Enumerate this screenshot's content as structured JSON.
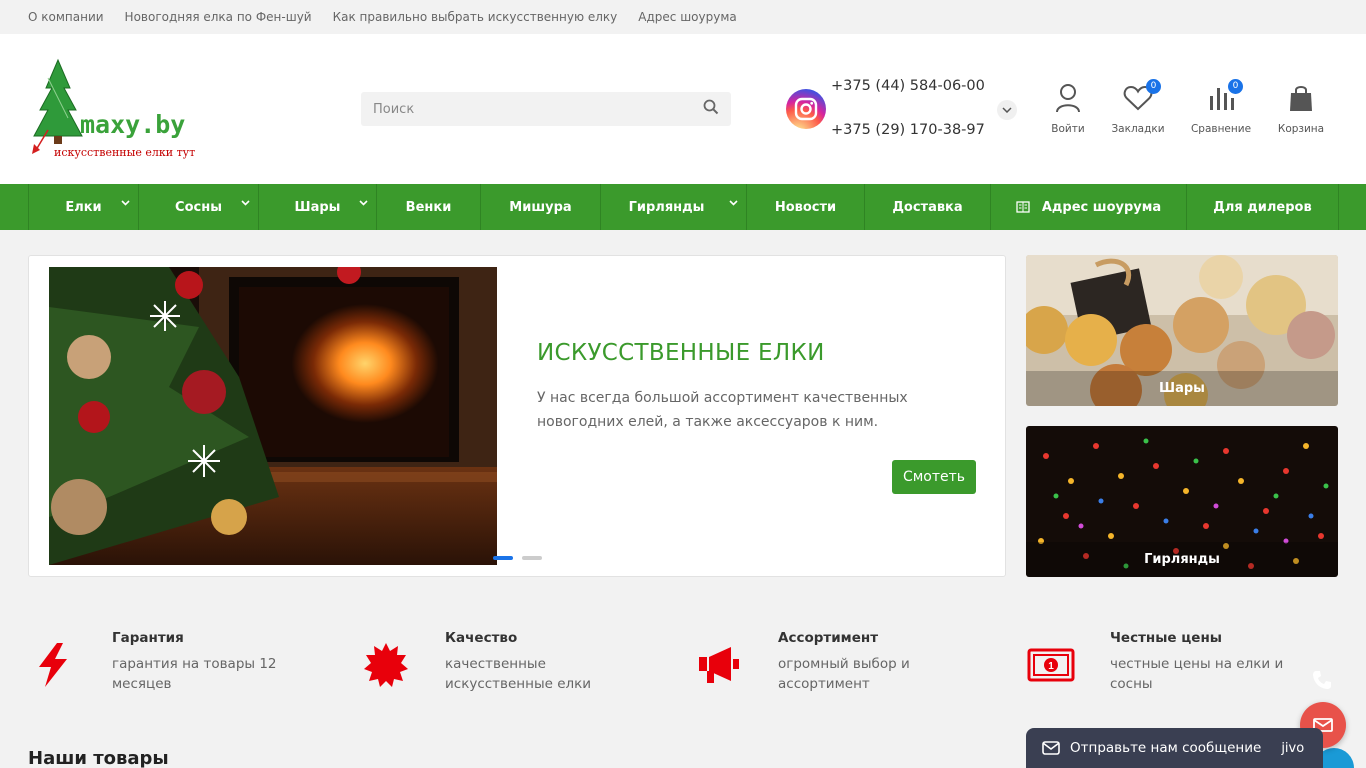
{
  "topbar": {
    "links": [
      "О компании",
      "Новогодняя елка по Фен-шуй",
      "Как правильно выбрать искусственную елку",
      "Адрес шоурума"
    ]
  },
  "header": {
    "logo_text": "maxy.by",
    "logo_tagline": "искусственные елки тут",
    "search_placeholder": "Поиск",
    "phones": [
      "+375 (44) 584-06-00",
      "+375 (29) 170-38-97"
    ],
    "icons": {
      "login": "Войти",
      "bookmarks": "Закладки",
      "bookmarks_count": "0",
      "compare": "Сравнение",
      "compare_count": "0",
      "cart": "Корзина"
    }
  },
  "nav": {
    "items": [
      {
        "label": "Елки",
        "dropdown": true
      },
      {
        "label": "Сосны",
        "dropdown": true
      },
      {
        "label": "Шары",
        "dropdown": true
      },
      {
        "label": "Венки",
        "dropdown": false
      },
      {
        "label": "Мишура",
        "dropdown": false
      },
      {
        "label": "Гирлянды",
        "dropdown": true
      },
      {
        "label": "Новости",
        "dropdown": false
      },
      {
        "label": "Доставка",
        "dropdown": false
      },
      {
        "label": "Адрес шоурума",
        "dropdown": false
      },
      {
        "label": "Для дилеров",
        "dropdown": false
      }
    ]
  },
  "slider": {
    "title": "ИСКУССТВЕННЫЕ ЕЛКИ",
    "description": "У нас всегда большой ассортимент качественных новогодних елей, а также аксессуаров к ним.",
    "button": "Смотеть",
    "slides_count": 2,
    "active_slide": 1
  },
  "categories": [
    {
      "label": "Шары"
    },
    {
      "label": "Гирлянды"
    }
  ],
  "features": [
    {
      "title": "Гарантия",
      "text": "гарантия на товары 12 месяцев"
    },
    {
      "title": "Качество",
      "text": "качественные искусственные елки"
    },
    {
      "title": "Ассортимент",
      "text": "огромный выбор и ассортимент"
    },
    {
      "title": "Честные цены",
      "text": "честные цены на елки и сосны"
    }
  ],
  "section": {
    "title": "Наши товары"
  },
  "chat": {
    "text": "Отправьте нам сообщение",
    "brand": "jivo"
  },
  "colors": {
    "green": "#3b9a2c",
    "red": "#e8000b",
    "blue": "#1a73e8"
  }
}
